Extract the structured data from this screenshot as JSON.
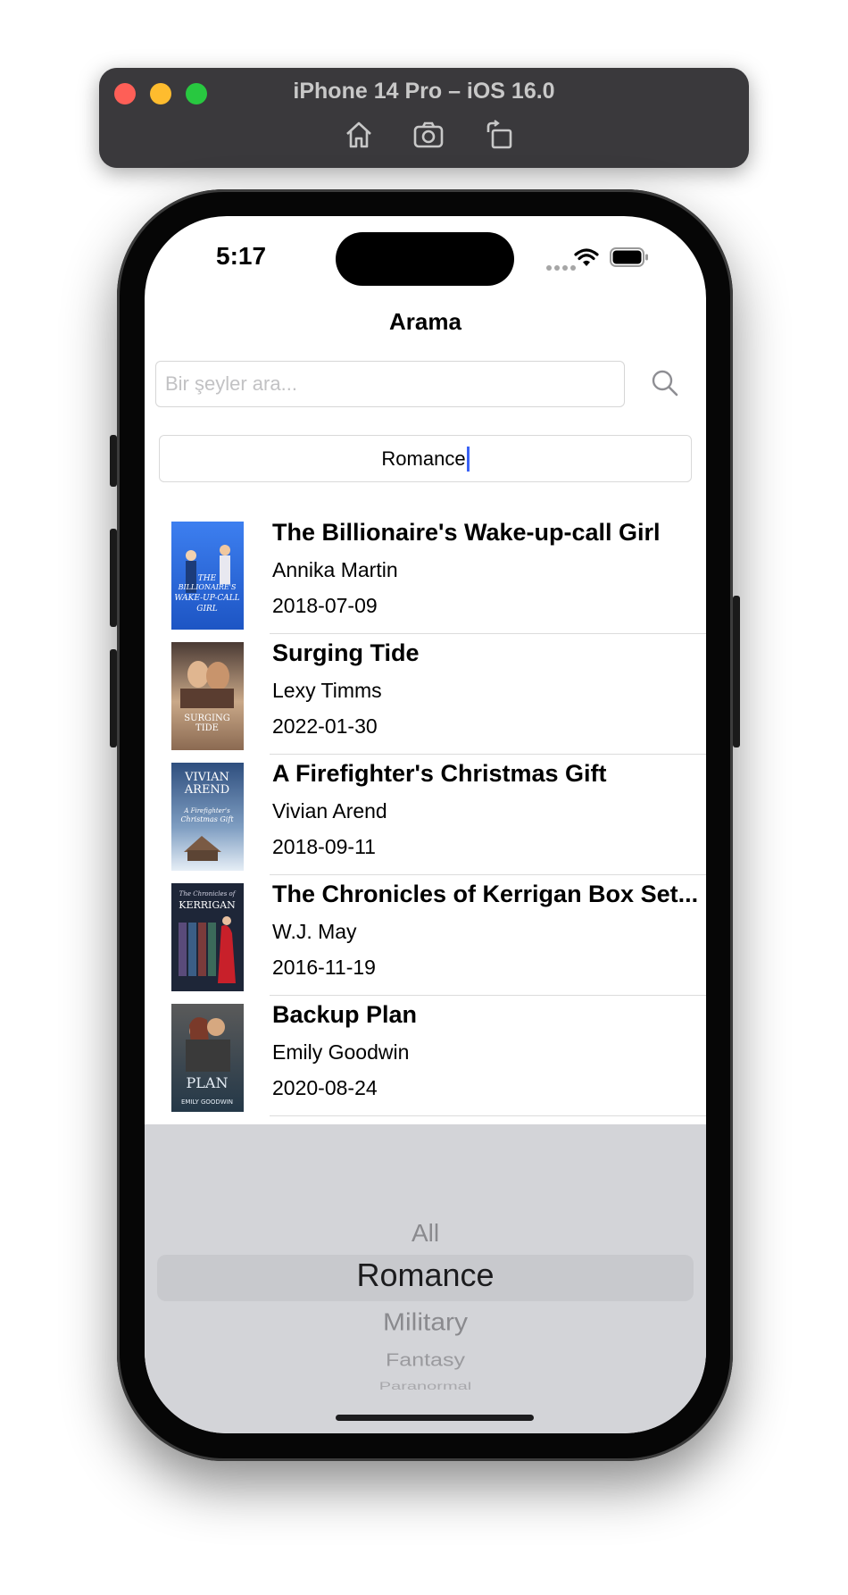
{
  "simulator": {
    "title": "iPhone 14 Pro – iOS 16.0",
    "tools": [
      "home-icon",
      "screenshot-icon",
      "rotate-icon"
    ]
  },
  "status_bar": {
    "time": "5:17"
  },
  "nav": {
    "title": "Arama"
  },
  "search": {
    "placeholder": "Bir şeyler ara...",
    "value": ""
  },
  "genre_field": {
    "value": "Romance"
  },
  "books": [
    {
      "title": "The Billionaire's Wake-up-call Girl",
      "author": "Annika Martin",
      "date": "2018-07-09",
      "cover_color": "#2f6fe0",
      "cover_text": ""
    },
    {
      "title": "Surging Tide",
      "author": "Lexy Timms",
      "date": "2022-01-30",
      "cover_color": "#b58a6a",
      "cover_text": ""
    },
    {
      "title": "A Firefighter's Christmas Gift",
      "author": "Vivian Arend",
      "date": "2018-09-11",
      "cover_color": "#4a6f9c",
      "cover_text": ""
    },
    {
      "title": "The Chronicles of Kerrigan Box Set...",
      "author": "W.J. May",
      "date": "2016-11-19",
      "cover_color": "#2a3348",
      "cover_text": ""
    },
    {
      "title": "Backup Plan",
      "author": "Emily Goodwin",
      "date": "2020-08-24",
      "cover_color": "#3d5a78",
      "cover_text": ""
    }
  ],
  "picker": {
    "options": [
      "All",
      "Romance",
      "Military",
      "Fantasy",
      "Paranormal"
    ],
    "selected": "Romance"
  },
  "colors": {
    "caret": "#3b63f5",
    "picker_bg": "#d3d4d8"
  }
}
